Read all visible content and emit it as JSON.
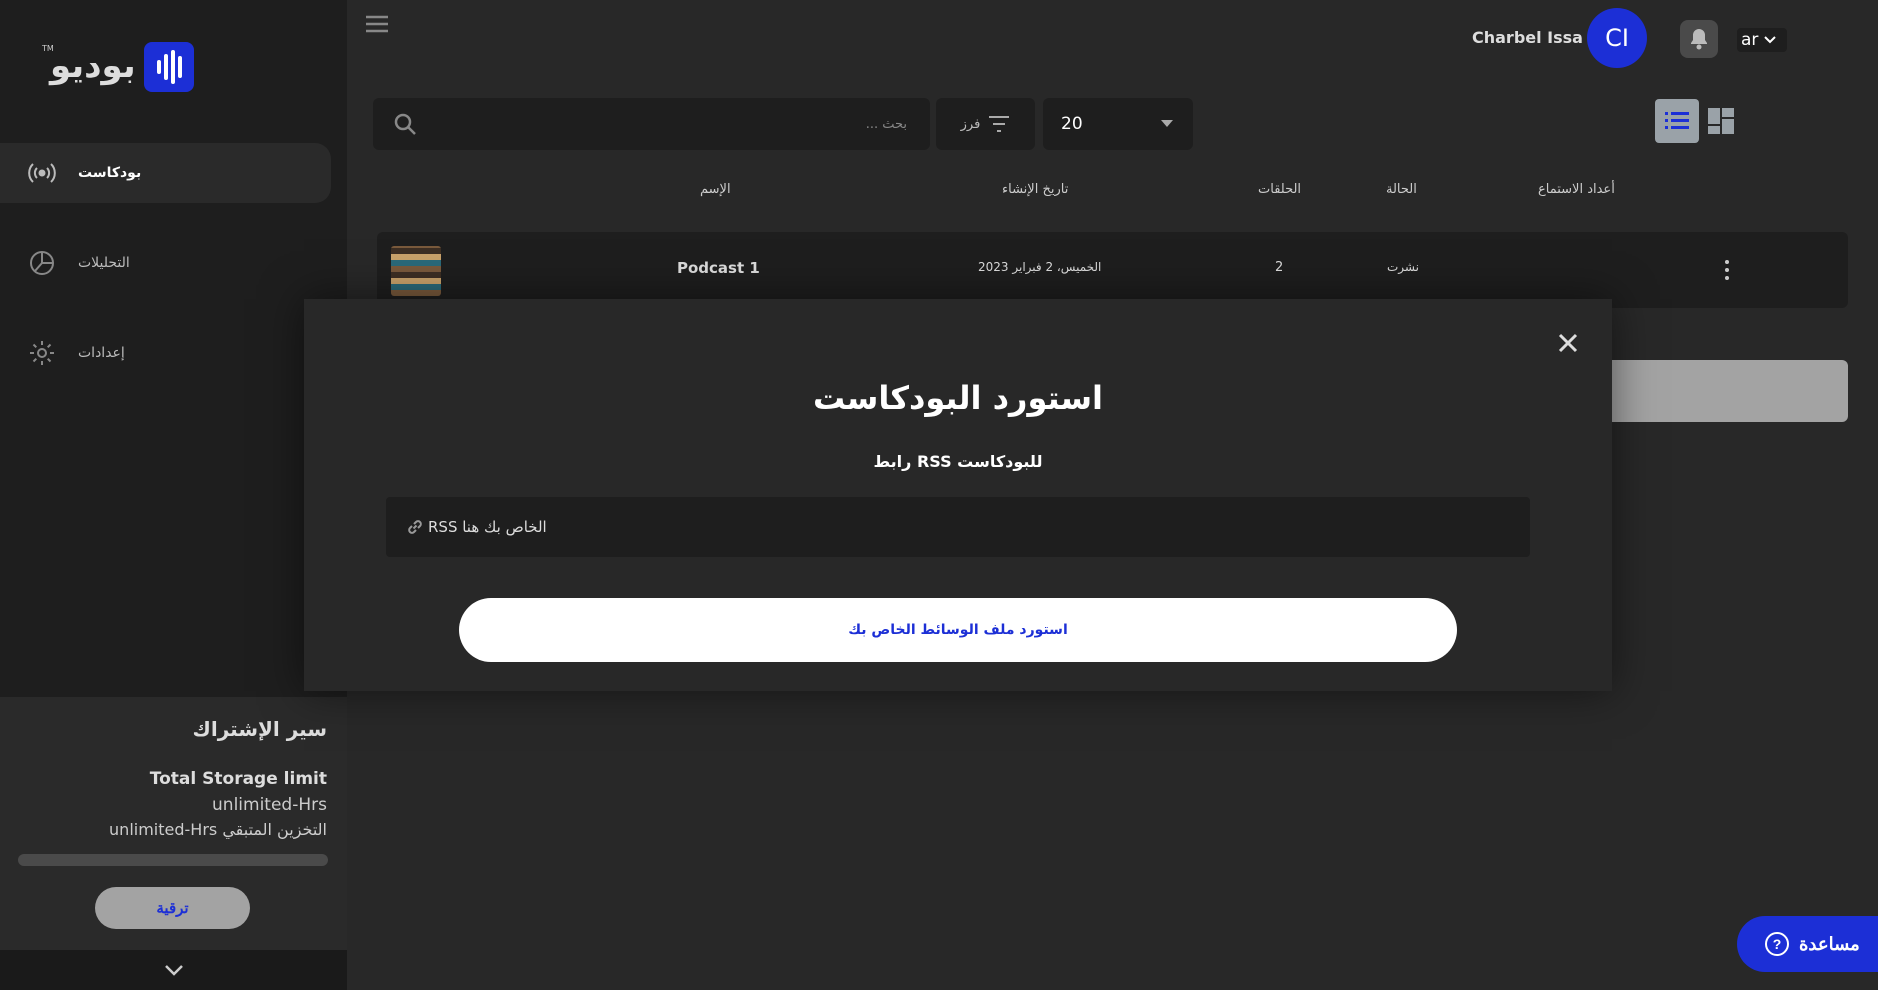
{
  "brand": {
    "logo_text": "بوديو",
    "tm": "TM"
  },
  "sidebar": {
    "items": [
      {
        "label": "بودكاست",
        "icon": "podcast-icon",
        "active": true
      },
      {
        "label": "التحليلات",
        "icon": "analytics-icon",
        "active": false
      },
      {
        "label": "إعدادات",
        "icon": "gear-icon",
        "active": false
      }
    ]
  },
  "subscription": {
    "title": "سير الإشتراك",
    "storage_limit_label": "Total Storage limit",
    "storage_limit_value": "unlimited-Hrs",
    "remaining": "unlimited-Hrs التخزين المتبقي",
    "progress": 0,
    "upgrade_label": "ترقية"
  },
  "header": {
    "user_name": "Charbel Issa",
    "avatar_initials": "CI",
    "language": "ar"
  },
  "toolbar": {
    "search_placeholder": "بحث ...",
    "sort_label": "فرز",
    "per_page": "20"
  },
  "table": {
    "headers": {
      "name": "الإسم",
      "created": "تاريخ الإنشاء",
      "episodes": "الحلقات",
      "status": "الحالة",
      "listens": "أعداد الاستماع"
    },
    "rows": [
      {
        "name": "Podcast 1",
        "created": "الخميس، 2 فبراير 2023",
        "episodes": "2",
        "status": "نشرت"
      }
    ]
  },
  "modal": {
    "title": "استورد البودكاست",
    "subtitle": "رابط RSS للبودكاست",
    "rss_placeholder": "RSS الخاص بك هنا",
    "import_button": "استورد ملف الوسائط الخاص بك"
  },
  "help": {
    "label": "مساعدة"
  },
  "colors": {
    "accent": "#1c2fd6",
    "background": "#282828",
    "sidebar": "#1e1e1e"
  }
}
